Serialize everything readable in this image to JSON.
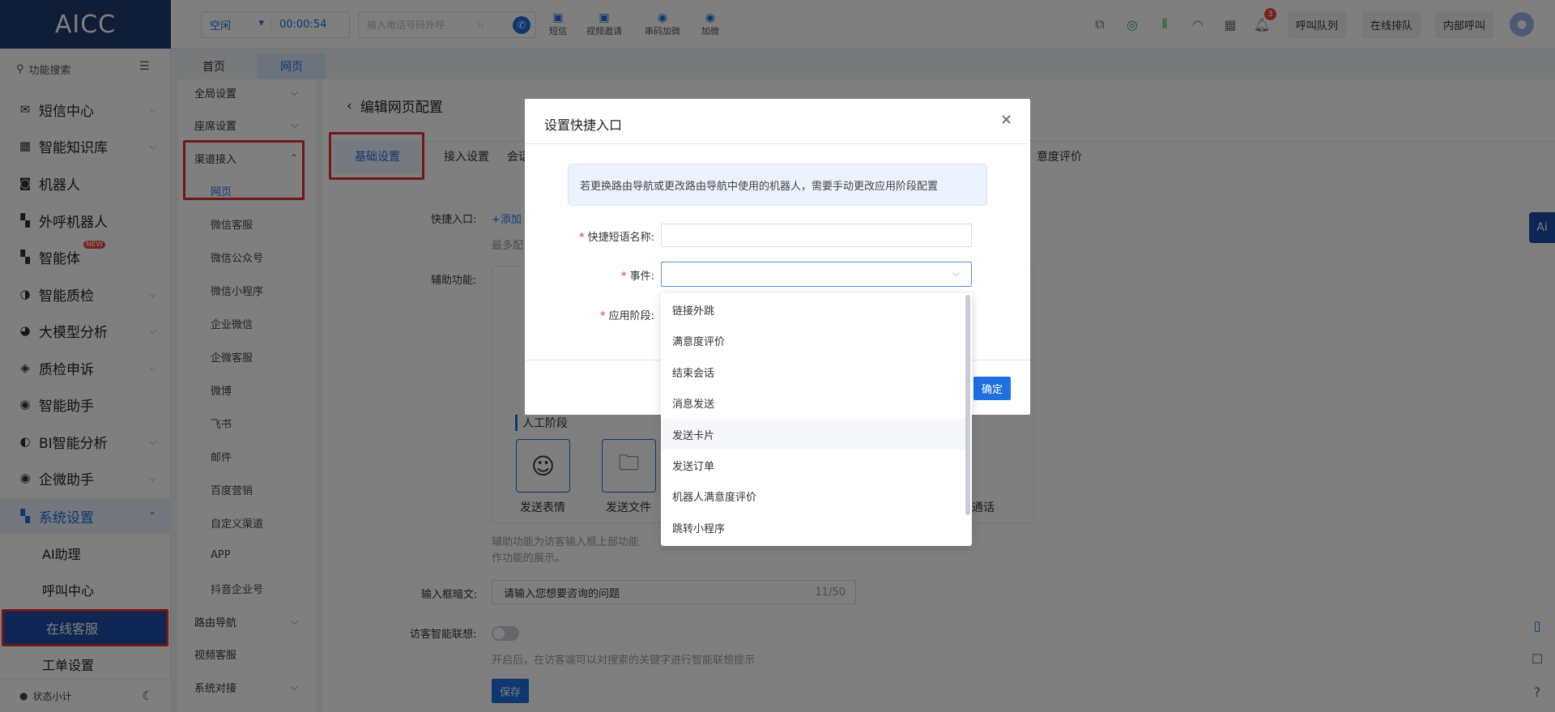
{
  "app": {
    "title": "AICC"
  },
  "topbar": {
    "status": "空闲",
    "timer": "00:00:54",
    "phone_placeholder": "输入电话号码外呼",
    "tools": [
      "短信",
      "视频邀请",
      "串码加微",
      "加微"
    ],
    "badge": "3",
    "buttons": [
      "呼叫队列",
      "在线排队",
      "内部呼叫"
    ]
  },
  "sidebar": {
    "search": "功能搜索",
    "items": [
      {
        "label": "短信中心"
      },
      {
        "label": "智能知识库"
      },
      {
        "label": "机器人"
      },
      {
        "label": "外呼机器人"
      },
      {
        "label": "智能体",
        "badge": "NEW"
      },
      {
        "label": "智能质检"
      },
      {
        "label": "大模型分析"
      },
      {
        "label": "质检申诉"
      },
      {
        "label": "智能助手"
      },
      {
        "label": "BI智能分析"
      },
      {
        "label": "企微助手"
      },
      {
        "label": "系统设置"
      }
    ],
    "subitems": [
      "AI助理",
      "呼叫中心",
      "在线客服",
      "工单设置"
    ],
    "footer": "状态小计"
  },
  "tabs": [
    "首页",
    "网页"
  ],
  "subnav": {
    "items": [
      "全局设置",
      "座席设置",
      "渠道接入"
    ],
    "channel_items": [
      "网页",
      "微信客服",
      "微信公众号",
      "微信小程序",
      "企业微信",
      "企微客服",
      "微博",
      "飞书",
      "邮件",
      "百度营销",
      "自定义渠道",
      "APP",
      "抖音企业号"
    ],
    "bottom_items": [
      "路由导航",
      "视频客服",
      "系统对接"
    ]
  },
  "main": {
    "title": "编辑网页配置",
    "tabs": [
      "基础设置",
      "接入设置",
      "会话",
      "意度评价"
    ],
    "quick_label": "快捷入口:",
    "quick_add": "+添加",
    "quick_hint": "最多配",
    "assist_label": "辅助功能:",
    "manual_stage": "人工阶段",
    "cards": [
      "发送表情",
      "发送文件",
      "通话"
    ],
    "assist_desc1": "辅助功能为访客输入框上部功能",
    "assist_desc2": "作功能的展示。",
    "placeholder_label": "输入框暗文:",
    "placeholder_value": "请输入您想要咨询的问题",
    "placeholder_count": "11/50",
    "assoc_label": "访客智能联想:",
    "assoc_desc": "开启后，在访客端可以对搜索的关键字进行智能联想提示",
    "save": "保存"
  },
  "modal": {
    "title": "设置快捷入口",
    "notice": "若更换路由导航或更改路由导航中使用的机器人，需要手动更改应用阶段配置",
    "name_label": "快捷短语名称:",
    "event_label": "事件:",
    "stage_label": "应用阶段:",
    "confirm": "确定"
  },
  "dropdown": {
    "options": [
      "链接外跳",
      "满意度评价",
      "结束会话",
      "消息发送",
      "发送卡片",
      "发送订单",
      "机器人满意度评价",
      "跳转小程序"
    ],
    "hovered": "发送卡片"
  },
  "colors": {
    "brand": "#1e3a6e",
    "accent": "#1f6fe0",
    "highlight": "#e52e2e"
  }
}
